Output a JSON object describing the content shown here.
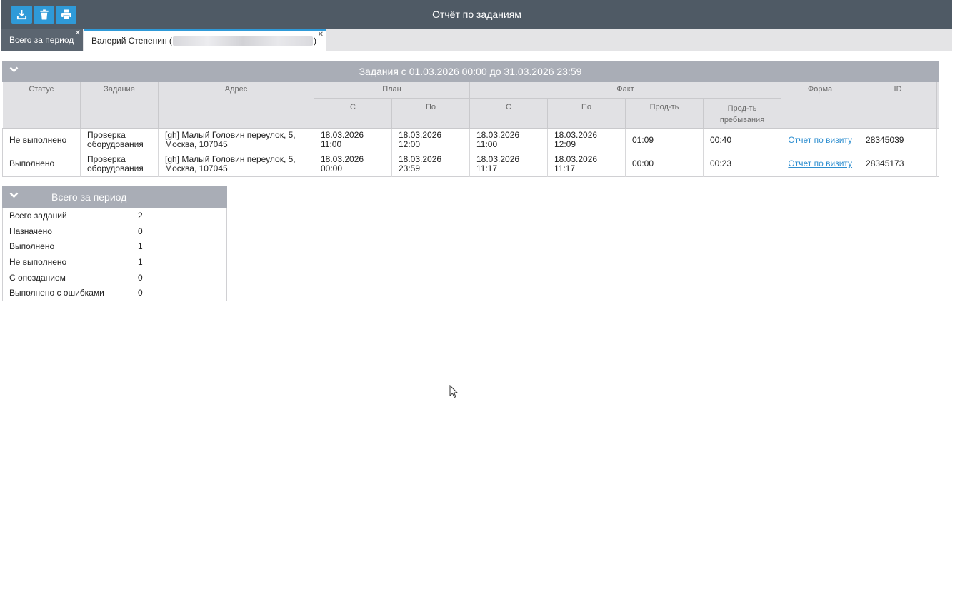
{
  "app": {
    "title": "Отчёт по заданиям"
  },
  "toolbar": {
    "buttons": [
      {
        "name": "download",
        "icon": "download-icon"
      },
      {
        "name": "delete",
        "icon": "trash-icon"
      },
      {
        "name": "print",
        "icon": "printer-icon"
      }
    ]
  },
  "tabs": [
    {
      "label": "Всего за период",
      "active": false
    },
    {
      "label_prefix": "Валерий Степенин (",
      "label_suffix": ")",
      "active": true
    }
  ],
  "tasks_panel": {
    "title": "Задания с 01.03.2026 00:00 до 31.03.2026 23:59",
    "headers": {
      "status": "Статус",
      "task": "Задание",
      "address": "Адрес",
      "plan": "План",
      "fact": "Факт",
      "form": "Форма",
      "id": "ID",
      "from": "С",
      "to": "По",
      "duration": "Прод-ть",
      "stay_duration": "Прод-ть пребывания"
    },
    "rows": [
      {
        "status": "Не выполнено",
        "task": "Проверка оборудования",
        "address": "[gh] Малый Головин переулок, 5, Москва, 107045",
        "plan_from": "18.03.2026 11:00",
        "plan_to": "18.03.2026 12:00",
        "fact_from": "18.03.2026 11:00",
        "fact_to": "18.03.2026 12:09",
        "duration": "01:09",
        "stay_duration": "00:40",
        "form": "Отчет по визиту",
        "id": "28345039"
      },
      {
        "status": "Выполнено",
        "task": "Проверка оборудования",
        "address": "[gh] Малый Головин переулок, 5, Москва, 107045",
        "plan_from": "18.03.2026 00:00",
        "plan_to": "18.03.2026 23:59",
        "fact_from": "18.03.2026 11:17",
        "fact_to": "18.03.2026 11:17",
        "duration": "00:00",
        "stay_duration": "00:23",
        "form": "Отчет по визиту",
        "id": "28345173"
      }
    ]
  },
  "summary_panel": {
    "title": "Всего за период",
    "rows": [
      {
        "label": "Всего заданий",
        "value": "2"
      },
      {
        "label": "Назначено",
        "value": "0"
      },
      {
        "label": "Выполнено",
        "value": "1"
      },
      {
        "label": "Не выполнено",
        "value": "1"
      },
      {
        "label": "С опозданием",
        "value": "0"
      },
      {
        "label": "Выполнено с ошибками",
        "value": "0"
      }
    ]
  },
  "colors": {
    "header_bar": "#4f5a65",
    "accent": "#2f9ad8",
    "panel_header": "#a9adb6",
    "link": "#2f8fd0"
  }
}
